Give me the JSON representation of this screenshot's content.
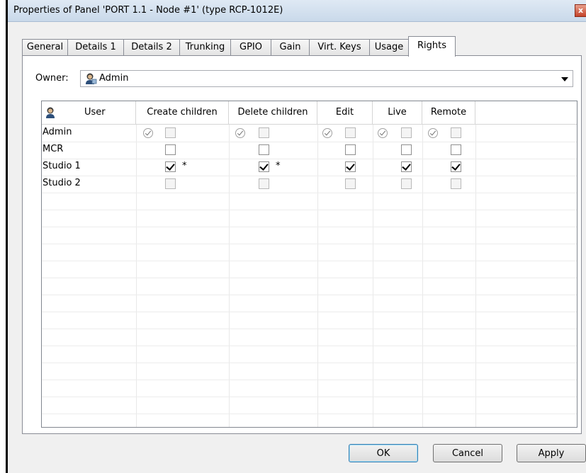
{
  "window": {
    "title": "Properties of Panel 'PORT 1.1 - Node #1' (type RCP-1012E)",
    "close_glyph": "x"
  },
  "tabs": [
    {
      "label": "General",
      "active": false
    },
    {
      "label": "Details 1",
      "active": false
    },
    {
      "label": "Details 2",
      "active": false
    },
    {
      "label": "Trunking",
      "active": false
    },
    {
      "label": "GPIO",
      "active": false
    },
    {
      "label": "Gain",
      "active": false
    },
    {
      "label": "Virt. Keys",
      "active": false
    },
    {
      "label": "Usage",
      "active": false
    },
    {
      "label": "Rights",
      "active": true
    }
  ],
  "owner": {
    "label": "Owner:",
    "value": "Admin",
    "icon": "user-icon"
  },
  "grid": {
    "header_icon": "user-icon",
    "columns": [
      "User",
      "Create children",
      "Delete children",
      "Edit",
      "Live",
      "Remote"
    ],
    "rows": [
      {
        "user": "Admin",
        "inherited": true,
        "cells": [
          {
            "checked": false,
            "disabled": true,
            "star": ""
          },
          {
            "checked": false,
            "disabled": true,
            "star": ""
          },
          {
            "checked": false,
            "disabled": true,
            "star": ""
          },
          {
            "checked": false,
            "disabled": true,
            "star": ""
          },
          {
            "checked": false,
            "disabled": true,
            "star": ""
          }
        ]
      },
      {
        "user": "MCR",
        "inherited": false,
        "cells": [
          {
            "checked": false,
            "disabled": false,
            "star": ""
          },
          {
            "checked": false,
            "disabled": false,
            "star": ""
          },
          {
            "checked": false,
            "disabled": false,
            "star": ""
          },
          {
            "checked": false,
            "disabled": false,
            "star": ""
          },
          {
            "checked": false,
            "disabled": false,
            "star": ""
          }
        ]
      },
      {
        "user": "Studio 1",
        "inherited": false,
        "cells": [
          {
            "checked": true,
            "disabled": false,
            "star": "*"
          },
          {
            "checked": true,
            "disabled": false,
            "star": "*"
          },
          {
            "checked": true,
            "disabled": false,
            "star": ""
          },
          {
            "checked": true,
            "disabled": false,
            "star": ""
          },
          {
            "checked": true,
            "disabled": false,
            "star": ""
          }
        ]
      },
      {
        "user": "Studio 2",
        "inherited": false,
        "cells": [
          {
            "checked": false,
            "disabled": true,
            "star": ""
          },
          {
            "checked": false,
            "disabled": true,
            "star": ""
          },
          {
            "checked": false,
            "disabled": true,
            "star": ""
          },
          {
            "checked": false,
            "disabled": true,
            "star": ""
          },
          {
            "checked": false,
            "disabled": true,
            "star": ""
          }
        ]
      }
    ]
  },
  "buttons": {
    "ok": "OK",
    "cancel": "Cancel",
    "apply": "Apply"
  }
}
